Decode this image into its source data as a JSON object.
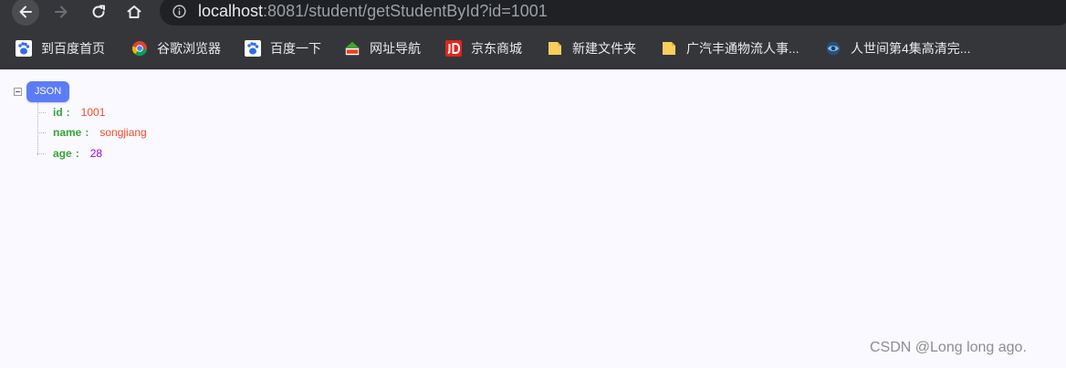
{
  "browser": {
    "url_host": "localhost",
    "url_rest": ":8081/student/getStudentById?id=1001",
    "bookmarks": [
      {
        "label": "到百度首页",
        "icon": "baidu-paw-icon"
      },
      {
        "label": "谷歌浏览器",
        "icon": "chrome-icon"
      },
      {
        "label": "百度一下",
        "icon": "baidu-paw-icon"
      },
      {
        "label": "网址导航",
        "icon": "2345-house-icon"
      },
      {
        "label": "京东商城",
        "icon": "jd-icon"
      },
      {
        "label": "新建文件夹",
        "icon": "folder-icon"
      },
      {
        "label": "广汽丰通物流人事...",
        "icon": "folder-icon"
      },
      {
        "label": "人世间第4集高清完...",
        "icon": "eye-globe-icon"
      }
    ]
  },
  "json_view": {
    "root_label": "JSON",
    "fields": [
      {
        "key": "id",
        "value": "1001",
        "type": "string"
      },
      {
        "key": "name",
        "value": "songjiang",
        "type": "string"
      },
      {
        "key": "age",
        "value": "28",
        "type": "number"
      }
    ],
    "colon": ":"
  },
  "watermark": "CSDN @Long long ago.",
  "colors": {
    "chrome_bg": "#35363a",
    "omnibox_bg": "#202124",
    "page_bg": "#f9f9ff",
    "badge": "#5c7cf5",
    "key": "#3aa13a",
    "string_value": "#f24a2a",
    "number_value": "#a000e6"
  }
}
